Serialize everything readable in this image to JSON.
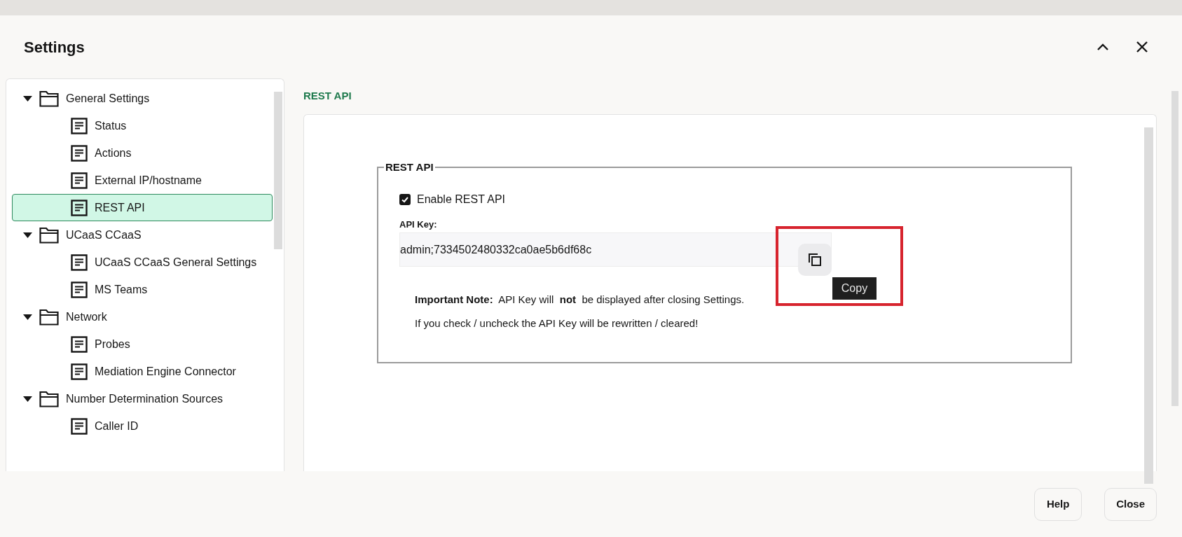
{
  "window": {
    "title": "Settings"
  },
  "sidebar": {
    "items": [
      {
        "label": "General Settings",
        "kind": "folder",
        "expanded": true,
        "selected": false,
        "children": [
          {
            "label": "Status",
            "kind": "page",
            "selected": false
          },
          {
            "label": "Actions",
            "kind": "page",
            "selected": false
          },
          {
            "label": "External IP/hostname",
            "kind": "page",
            "selected": false
          },
          {
            "label": "REST API",
            "kind": "page",
            "selected": true
          }
        ]
      },
      {
        "label": "UCaaS CCaaS",
        "kind": "folder",
        "expanded": true,
        "selected": false,
        "children": [
          {
            "label": "UCaaS CCaaS General Settings",
            "kind": "page",
            "selected": false
          },
          {
            "label": "MS Teams",
            "kind": "page",
            "selected": false
          }
        ]
      },
      {
        "label": "Network",
        "kind": "folder",
        "expanded": true,
        "selected": false,
        "children": [
          {
            "label": "Probes",
            "kind": "page",
            "selected": false
          },
          {
            "label": "Mediation Engine Connector",
            "kind": "page",
            "selected": false
          }
        ]
      },
      {
        "label": "Number Determination Sources",
        "kind": "folder",
        "expanded": true,
        "selected": false,
        "children": [
          {
            "label": "Caller ID",
            "kind": "page",
            "selected": false
          }
        ]
      }
    ]
  },
  "content": {
    "heading": "REST API",
    "fieldset": {
      "legend": "REST API",
      "enable": {
        "label": "Enable REST API",
        "checked": true
      },
      "api_key": {
        "label": "API Key:",
        "value": "admin;7334502480332ca0ae5b6df68c"
      },
      "copy_tooltip": "Copy",
      "notes": [
        "**Important Note:**  API Key will  **not**  be displayed after closing Settings.",
        "If you check / uncheck the API Key will be rewritten / cleared!"
      ]
    }
  },
  "footer": {
    "buttons": [
      "Help",
      "Close"
    ]
  }
}
